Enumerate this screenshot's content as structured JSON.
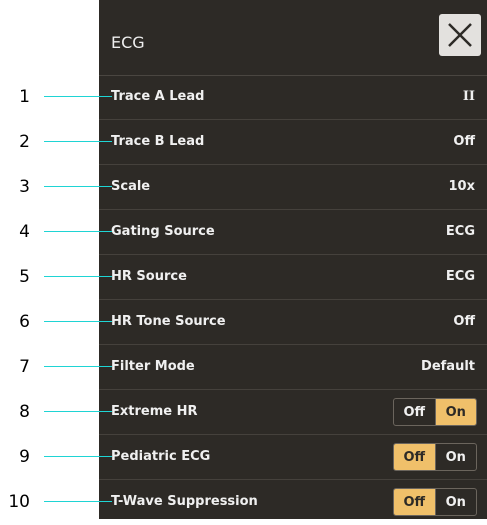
{
  "panel": {
    "title": "ECG",
    "close_icon": "close-icon",
    "colors": {
      "background": "#2d2a26",
      "selected": "#f0c06a",
      "callout_line": "#1fd4d4"
    }
  },
  "rows": [
    {
      "label": "Trace A Lead",
      "value": "II"
    },
    {
      "label": "Trace B Lead",
      "value": "Off"
    },
    {
      "label": "Scale",
      "value": "10x"
    },
    {
      "label": "Gating Source",
      "value": "ECG"
    },
    {
      "label": "HR Source",
      "value": "ECG"
    },
    {
      "label": "HR Tone Source",
      "value": "Off"
    },
    {
      "label": "Filter Mode",
      "value": "Default"
    },
    {
      "label": "Extreme HR",
      "toggle": {
        "off_label": "Off",
        "on_label": "On",
        "selected": "On"
      }
    },
    {
      "label": "Pediatric ECG",
      "toggle": {
        "off_label": "Off",
        "on_label": "On",
        "selected": "Off"
      }
    },
    {
      "label": "T-Wave Suppression",
      "toggle": {
        "off_label": "Off",
        "on_label": "On",
        "selected": "Off"
      }
    }
  ],
  "callouts": [
    "1",
    "2",
    "3",
    "4",
    "5",
    "6",
    "7",
    "8",
    "9",
    "10"
  ]
}
